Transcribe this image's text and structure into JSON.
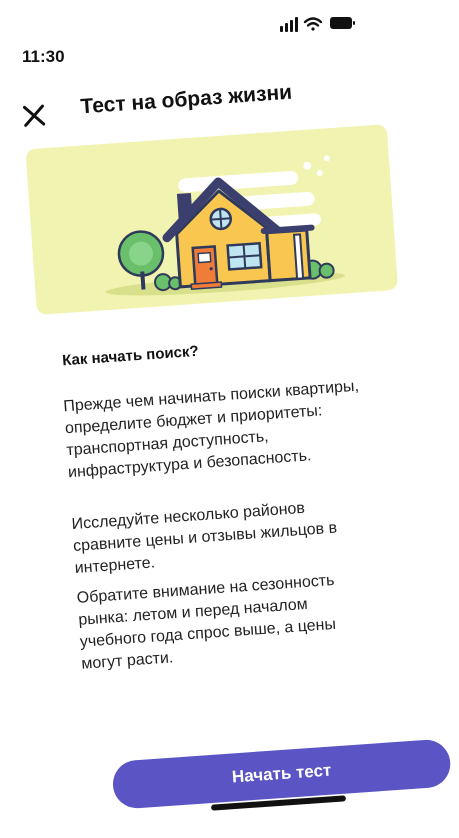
{
  "status_bar": {
    "time": "11:30"
  },
  "header": {
    "title": "Тест на образ жизни",
    "close_icon": "close-icon"
  },
  "hero": {
    "illustration": "house-illustration"
  },
  "content": {
    "heading": "Как начать поиск?",
    "paragraphs": [
      "Прежде чем начинать поиски квартиры, определите бюджет и приоритеты: транспортная доступность, инфраструктура и безопасность.",
      "Исследуйте несколько районов сравните цены и отзывы жильцов в интернете.",
      "Обратите внимание на сезонность рынка: летом и перед началом учебного года спрос выше, а цены могут расти."
    ]
  },
  "footer": {
    "start_label": "Начать тест"
  },
  "colors": {
    "accent": "#5a54c4",
    "hero_bg": "#f1f3b0",
    "house": "#f9c74f",
    "door": "#f07c3a",
    "roof": "#3b3f6e"
  }
}
